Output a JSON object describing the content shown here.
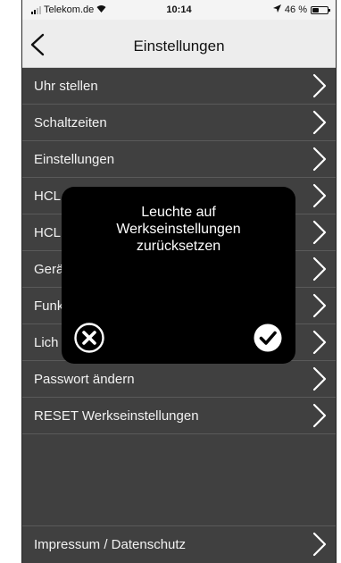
{
  "status_bar": {
    "carrier": "Telekom.de",
    "time": "10:14",
    "battery": "46 %",
    "battery_level": 0.46
  },
  "nav": {
    "title": "Einstellungen",
    "back_icon": "chevron-left-icon"
  },
  "menu": {
    "items": [
      {
        "label": "Uhr stellen"
      },
      {
        "label": "Schaltzeiten"
      },
      {
        "label": "Einstellungen"
      },
      {
        "label": "HCL"
      },
      {
        "label": "HCL"
      },
      {
        "label": "Gerä"
      },
      {
        "label": "Funk"
      },
      {
        "label": "Lich"
      },
      {
        "label": "Passwort ändern"
      },
      {
        "label": "RESET Werkseinstellungen"
      }
    ],
    "footer_item": {
      "label": "Impressum / Datenschutz"
    },
    "chevron_icon": "chevron-right-icon"
  },
  "dialog": {
    "message": "Leuchte auf\nWerkseinstellungen\nzurücksetzen",
    "cancel_icon": "cancel-circle-icon",
    "confirm_icon": "confirm-check-icon"
  },
  "colors": {
    "menu_background": "#404040",
    "separator": "#5a5a5a",
    "dialog_background": "#000000",
    "nav_background": "#ededed"
  }
}
